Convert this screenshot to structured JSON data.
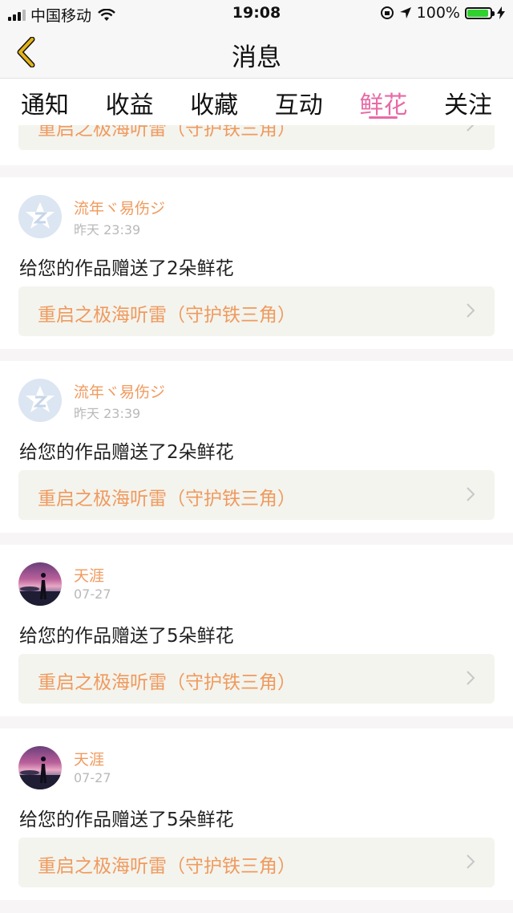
{
  "status_bar": {
    "carrier": "中国移动",
    "time": "19:08",
    "battery": "100%",
    "battery_level": 1.0
  },
  "nav": {
    "title": "消息"
  },
  "tabs": [
    {
      "label": "通知"
    },
    {
      "label": "收益"
    },
    {
      "label": "收藏"
    },
    {
      "label": "互动"
    },
    {
      "label": "鲜花"
    },
    {
      "label": "关注"
    }
  ],
  "active_tab": "鲜花",
  "partial_item": {
    "work_title": "重启之极海听雷（守护铁三角）"
  },
  "items": [
    {
      "user": "流年ヾ易伤ジ",
      "time": "昨天 23:39",
      "message": "给您的作品赠送了2朵鲜花",
      "work_title": "重启之极海听雷（守护铁三角）",
      "avatar": "default"
    },
    {
      "user": "流年ヾ易伤ジ",
      "time": "昨天 23:39",
      "message": "给您的作品赠送了2朵鲜花",
      "work_title": "重启之极海听雷（守护铁三角）",
      "avatar": "default"
    },
    {
      "user": "天涯",
      "time": "07-27",
      "message": "给您的作品赠送了5朵鲜花",
      "work_title": "重启之极海听雷（守护铁三角）",
      "avatar": "photo"
    },
    {
      "user": "天涯",
      "time": "07-27",
      "message": "给您的作品赠送了5朵鲜花",
      "work_title": "重启之极海听雷（守护铁三角）",
      "avatar": "photo"
    }
  ],
  "colors": {
    "accent": "#e86aa6",
    "orange_text": "#f09a5e",
    "back_arrow": "#e5b318",
    "link_bg": "#f3f4ee"
  }
}
